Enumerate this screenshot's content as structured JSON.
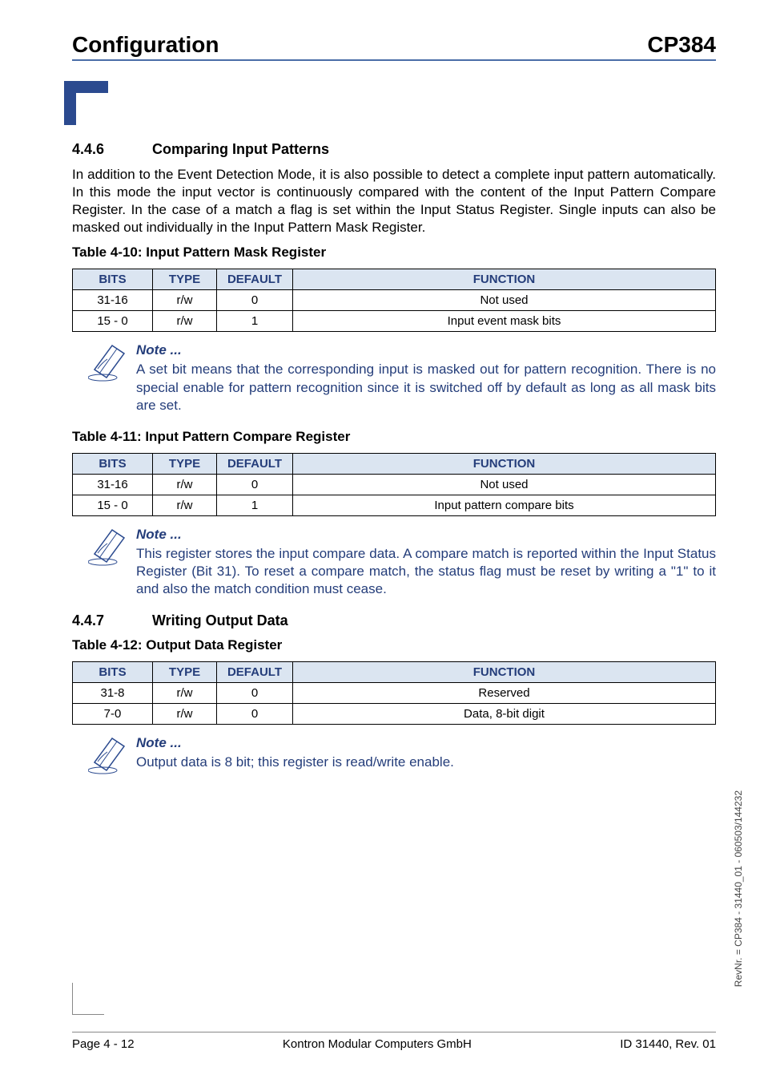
{
  "header": {
    "left": "Configuration",
    "right": "CP384"
  },
  "section1": {
    "num": "4.4.6",
    "title": "Comparing Input Patterns",
    "para": "In addition to the Event Detection Mode, it is also possible to detect a complete input pattern automatically. In this mode the input vector is continuously compared with the content of the Input Pattern Compare Register. In the case of a match a flag is set within the Input Status Register. Single inputs can also be masked out individually in the Input Pattern Mask Register."
  },
  "table10": {
    "caption": "Table 4-10:  Input Pattern Mask Register",
    "headers": {
      "bits": "BITS",
      "type": "TYPE",
      "default": "DEFAULT",
      "func": "FUNCTION"
    },
    "rows": [
      {
        "bits": "31-16",
        "type": "r/w",
        "default": "0",
        "func": "Not used"
      },
      {
        "bits": "15 - 0",
        "type": "r/w",
        "default": "1",
        "func": "Input event mask bits"
      }
    ]
  },
  "note1": {
    "title": "Note ...",
    "body": "A set bit means that the corresponding input is masked out for pattern recognition. There is no special enable for pattern recognition since it is switched off by default as long as all mask bits are set."
  },
  "table11": {
    "caption": "Table 4-11:  Input Pattern Compare Register",
    "headers": {
      "bits": "BITS",
      "type": "TYPE",
      "default": "DEFAULT",
      "func": "FUNCTION"
    },
    "rows": [
      {
        "bits": "31-16",
        "type": "r/w",
        "default": "0",
        "func": "Not used"
      },
      {
        "bits": "15 - 0",
        "type": "r/w",
        "default": "1",
        "func": "Input pattern compare bits"
      }
    ]
  },
  "note2": {
    "title": "Note ...",
    "body": "This register stores the input compare data. A compare match is reported within the Input Status Register (Bit 31). To reset a compare match, the status flag must be reset by writing a \"1\" to it and also the match condition must cease."
  },
  "section2": {
    "num": "4.4.7",
    "title": "Writing Output Data"
  },
  "table12": {
    "caption": "Table 4-12:  Output Data Register",
    "headers": {
      "bits": "BITS",
      "type": "TYPE",
      "default": "DEFAULT",
      "func": "FUNCTION"
    },
    "rows": [
      {
        "bits": "31-8",
        "type": "r/w",
        "default": "0",
        "func": "Reserved"
      },
      {
        "bits": "7-0",
        "type": "r/w",
        "default": "0",
        "func": "Data, 8-bit digit"
      }
    ]
  },
  "note3": {
    "title": "Note ...",
    "body": "Output data is 8 bit; this register is read/write enable."
  },
  "footer": {
    "left": "Page 4 - 12",
    "center": "Kontron Modular Computers GmbH",
    "right": "ID 31440, Rev. 01"
  },
  "vertical": "RevNr. = CP384 - 31440_01 - 060503/144232"
}
